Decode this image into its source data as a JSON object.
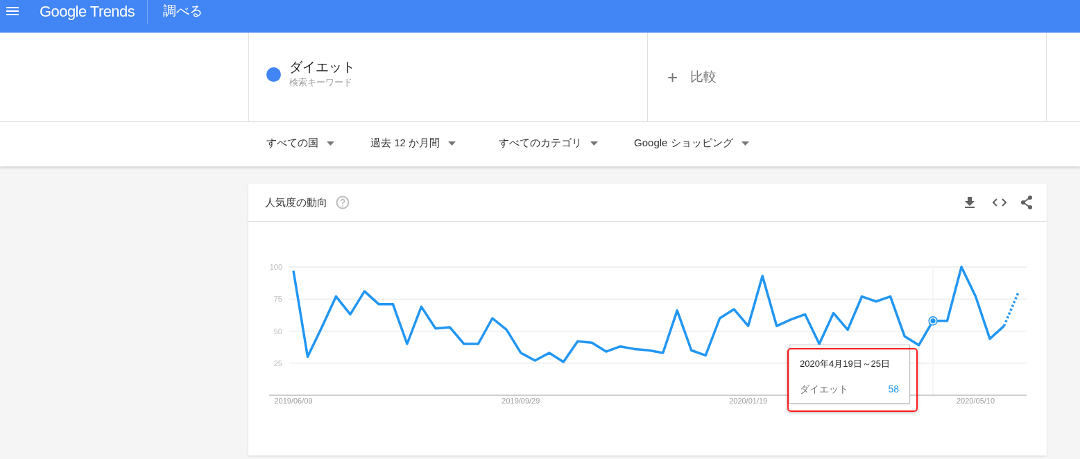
{
  "header": {
    "logo": "Google Trends",
    "section": "調べる"
  },
  "search_terms": [
    {
      "term": "ダイエット",
      "subtitle": "検索キーワード",
      "color": "#4285f4"
    }
  ],
  "compare": {
    "icon": "+",
    "label": "比較"
  },
  "filters": [
    {
      "label": "すべての国"
    },
    {
      "label": "過去 12 か月間"
    },
    {
      "label": "すべてのカテゴリ"
    },
    {
      "label": "Google ショッピング"
    }
  ],
  "trend_card": {
    "title": "人気度の動向",
    "chart_data": {
      "type": "line",
      "categories": [
        "2019/06/09",
        null,
        null,
        null,
        null,
        null,
        null,
        null,
        null,
        null,
        null,
        null,
        null,
        null,
        null,
        null,
        "2019/09/29",
        null,
        null,
        null,
        null,
        null,
        null,
        null,
        null,
        null,
        null,
        null,
        null,
        null,
        null,
        null,
        "2020/01/19",
        null,
        null,
        null,
        null,
        null,
        null,
        null,
        null,
        null,
        null,
        null,
        null,
        null,
        null,
        null,
        "2020/05/10",
        null,
        null,
        null
      ],
      "series": [
        {
          "name": "ダイエット",
          "color": "#2196f3",
          "values": [
            97,
            30,
            53,
            77,
            63,
            81,
            71,
            71,
            40,
            69,
            52,
            53,
            40,
            40,
            60,
            51,
            33,
            27,
            33,
            26,
            42,
            41,
            34,
            38,
            36,
            35,
            33,
            66,
            35,
            31,
            60,
            67,
            54,
            93,
            54,
            59,
            63,
            40,
            64,
            51,
            77,
            73,
            77,
            46,
            39,
            58,
            58,
            100,
            77,
            44,
            54,
            80
          ]
        }
      ],
      "ylim": [
        0,
        100
      ],
      "yticks": [
        25,
        50,
        75,
        100
      ],
      "grid": true
    },
    "tooltip": {
      "date": "2020年4月19日～25日",
      "value": "58",
      "highlighted": true
    }
  }
}
